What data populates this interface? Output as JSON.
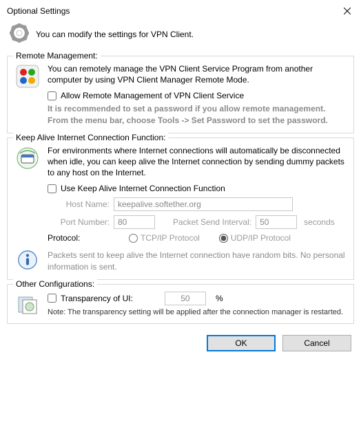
{
  "window": {
    "title": "Optional Settings"
  },
  "header": {
    "subtitle": "You can modify the settings for VPN Client."
  },
  "remote": {
    "legend": "Remote Management:",
    "desc": "You can remotely manage the VPN Client Service Program from another computer by using VPN Client Manager Remote Mode.",
    "allow_label": "Allow Remote Management of VPN Client Service",
    "hint": "It is recommended to set a password if you allow remote management. From the menu bar, choose Tools -> Set Password to set the password."
  },
  "keepalive": {
    "legend": "Keep Alive Internet Connection Function:",
    "desc": "For environments where Internet connections will automatically be disconnected when idle, you can keep alive the Internet connection by sending dummy packets to any host on the Internet.",
    "use_label": "Use Keep Alive Internet Connection Function",
    "host_label": "Host Name:",
    "host_value": "keepalive.softether.org",
    "port_label": "Port Number:",
    "port_value": "80",
    "interval_label": "Packet Send Interval:",
    "interval_value": "50",
    "interval_unit": "seconds",
    "protocol_label": "Protocol:",
    "tcp_label": "TCP/IP Protocol",
    "udp_label": "UDP/IP Protocol",
    "privacy": "Packets sent to keep alive the Internet connection have random bits. No personal information is sent."
  },
  "other": {
    "legend": "Other Configurations:",
    "transparency_label": "Transparency of UI:",
    "transparency_value": "50",
    "percent": "%",
    "note": "Note: The transparency setting will be applied after the connection manager is restarted."
  },
  "buttons": {
    "ok": "OK",
    "cancel": "Cancel"
  }
}
